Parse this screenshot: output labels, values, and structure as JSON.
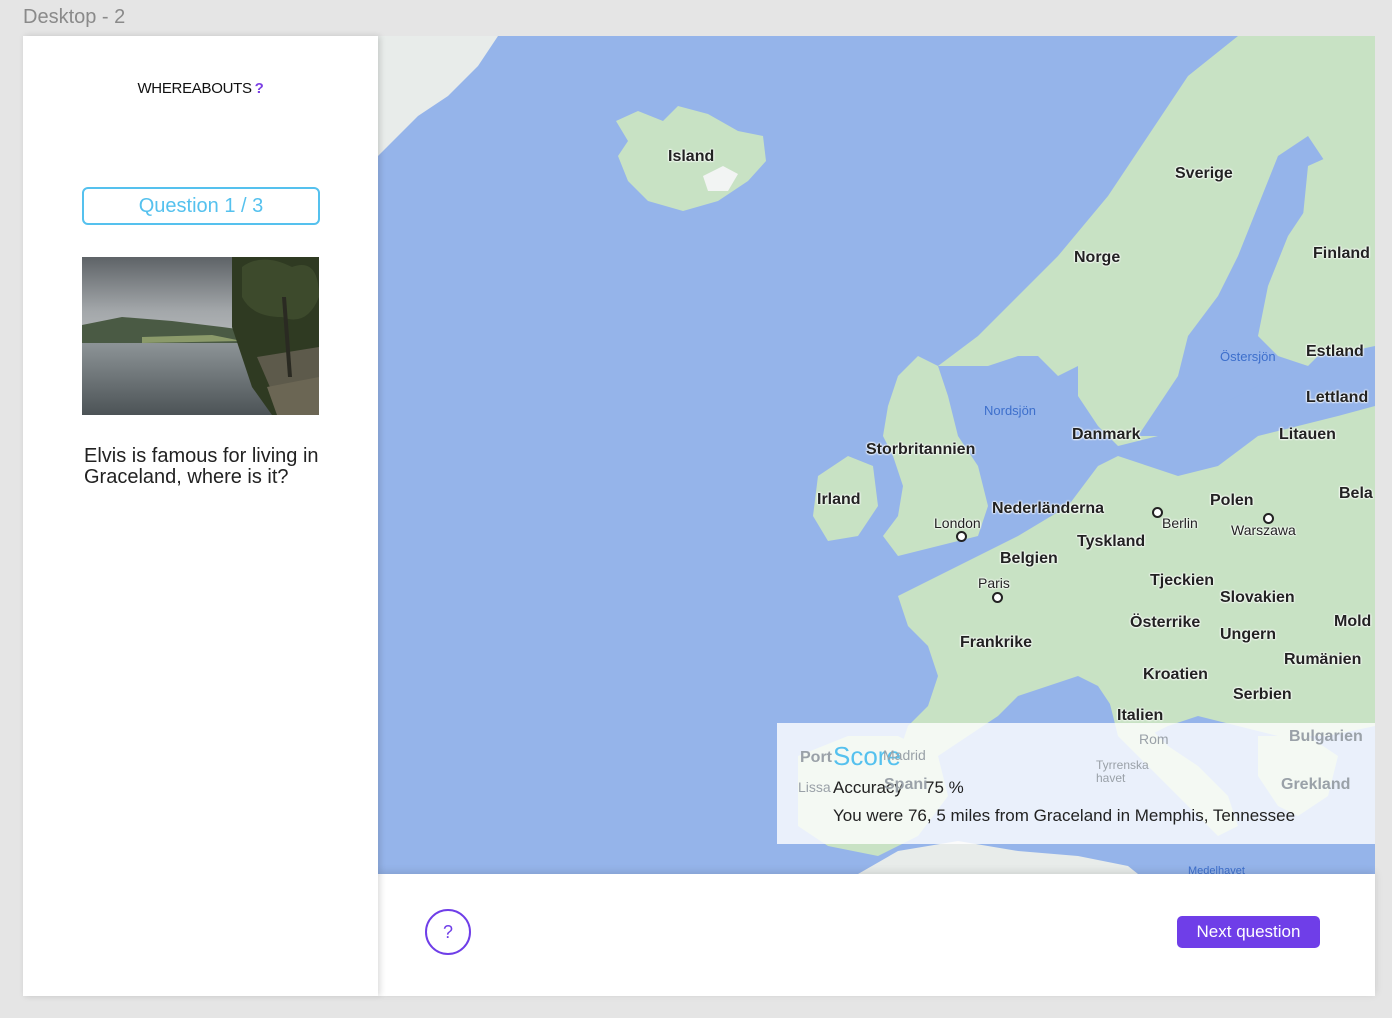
{
  "frame": {
    "title": "Desktop - 2"
  },
  "brand": {
    "name": "WHEREABOUTS",
    "mark": "?"
  },
  "question": {
    "counter": "Question 1 / 3",
    "text": "Elvis is famous for living in Graceland, where is it?"
  },
  "map": {
    "labels": {
      "island": "Island",
      "sverige": "Sverige",
      "norge": "Norge",
      "finland": "Finland",
      "ostersjon": "Östersjön",
      "estland": "Estland",
      "lettland": "Lettland",
      "nordsjon": "Nordsjön",
      "danmark": "Danmark",
      "litauen": "Litauen",
      "storbritannien": "Storbritannien",
      "irland": "Irland",
      "nederlanderna": "Nederländerna",
      "berlin": "Berlin",
      "polen": "Polen",
      "bela": "Bela",
      "london": "London",
      "warszawa": "Warszawa",
      "tyskland": "Tyskland",
      "belgien": "Belgien",
      "paris": "Paris",
      "tjeckien": "Tjeckien",
      "slovakien": "Slovakien",
      "osterrike": "Österrike",
      "ungern": "Ungern",
      "mold": "Mold",
      "frankrike": "Frankrike",
      "rumanien": "Rumänien",
      "kroatien": "Kroatien",
      "serbien": "Serbien",
      "italien": "Italien",
      "rom": "Rom",
      "bulgarien": "Bulgarien",
      "grekland": "Grekland",
      "madrid": "Madrid",
      "lissabon": "Lissa",
      "tyrrenska": "Tyrrenska havet",
      "medelhavet": "Medelhavet",
      "portugal": "Port",
      "spanien": "Spani"
    },
    "colors": {
      "water": "#95b4ea",
      "land": "#c8e2c4",
      "accent": "#6f3ee8",
      "highlight": "#55c1ee"
    }
  },
  "score": {
    "title": "Score",
    "accuracy_label": "Accuracy",
    "accuracy_value": "75 %",
    "distance_text": "You were 76, 5 miles from Graceland in Memphis, Tennessee"
  },
  "actions": {
    "help": "?",
    "next": "Next question"
  }
}
